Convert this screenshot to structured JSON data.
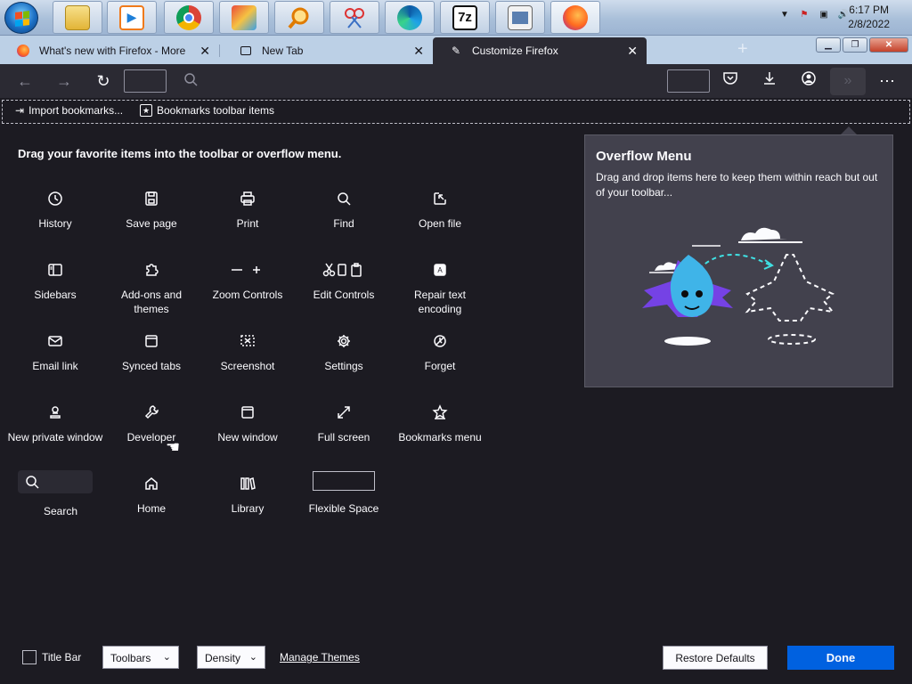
{
  "taskbar": {
    "apps": [
      {
        "icon": "file-explorer-icon"
      },
      {
        "icon": "media-player-icon"
      },
      {
        "icon": "chrome-icon"
      },
      {
        "icon": "paint-app-icon"
      },
      {
        "icon": "magnifier-icon"
      },
      {
        "icon": "snipping-tool-icon"
      },
      {
        "icon": "edge-icon"
      },
      {
        "icon": "7zip-icon",
        "text": "7z"
      },
      {
        "icon": "document-window-icon"
      },
      {
        "icon": "firefox-icon"
      }
    ],
    "clock": {
      "time": "6:17 PM",
      "date": "2/8/2022"
    }
  },
  "tabs": [
    {
      "label": "What's new with Firefox - More p",
      "icon": "firefox-icon"
    },
    {
      "label": "New Tab",
      "icon": "new-tab-page-icon"
    },
    {
      "label": "Customize Firefox",
      "icon": "customize-icon"
    }
  ],
  "bookmarks_toolbar": {
    "import_label": "Import bookmarks...",
    "items_label": "Bookmarks toolbar items"
  },
  "palette": {
    "title": "Drag your favorite items into the toolbar or overflow menu.",
    "items": [
      {
        "label": "History"
      },
      {
        "label": "Save page"
      },
      {
        "label": "Print"
      },
      {
        "label": "Find"
      },
      {
        "label": "Open file"
      },
      {
        "label": "Sidebars"
      },
      {
        "label": "Add-ons and themes"
      },
      {
        "label": "Zoom Controls"
      },
      {
        "label": "Edit Controls"
      },
      {
        "label": "Repair text encoding"
      },
      {
        "label": "Email link"
      },
      {
        "label": "Synced tabs"
      },
      {
        "label": "Screenshot"
      },
      {
        "label": "Settings"
      },
      {
        "label": "Forget"
      },
      {
        "label": "New private window"
      },
      {
        "label": "Developer"
      },
      {
        "label": "New window"
      },
      {
        "label": "Full screen"
      },
      {
        "label": "Bookmarks menu"
      },
      {
        "label": "Search"
      },
      {
        "label": "Home"
      },
      {
        "label": "Library"
      },
      {
        "label": "Flexible Space"
      }
    ]
  },
  "overflow_menu": {
    "title": "Overflow Menu",
    "description": "Drag and drop items here to keep them within reach but out of your toolbar..."
  },
  "footer": {
    "title_bar_label": "Title Bar",
    "toolbars_label": "Toolbars",
    "density_label": "Density",
    "manage_themes_label": "Manage Themes",
    "restore_label": "Restore Defaults",
    "done_label": "Done"
  },
  "colors": {
    "accent": "#0061e0",
    "background": "#1c1b22",
    "toolbar": "#2b2a33",
    "panel": "#42414d"
  }
}
